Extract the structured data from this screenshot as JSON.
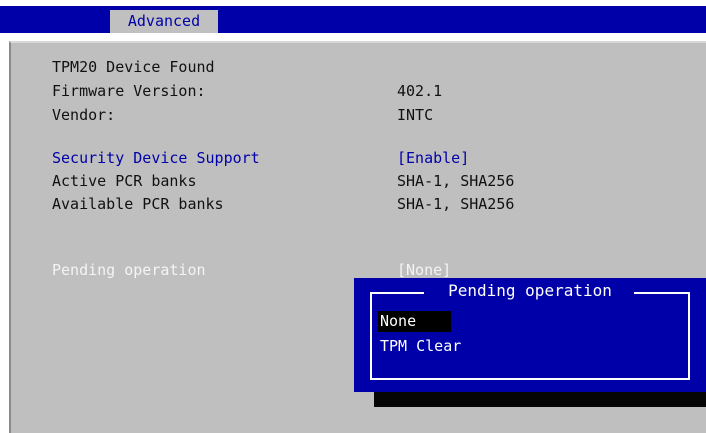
{
  "header": {
    "tab_label": "Advanced"
  },
  "info": {
    "tpm_device": "TPM20 Device Found",
    "firmware_label": "Firmware Version:",
    "firmware_value": "402.1",
    "vendor_label": "Vendor:",
    "vendor_value": "INTC"
  },
  "settings": {
    "security_label": "Security Device Support",
    "security_value": "[Enable]",
    "active_pcr_label": "Active PCR banks",
    "active_pcr_value": "SHA-1, SHA256",
    "available_pcr_label": "Available PCR banks",
    "available_pcr_value": "SHA-1, SHA256",
    "pending_label": "Pending operation",
    "pending_value": "[None]"
  },
  "popup": {
    "title": "Pending operation",
    "options": [
      "None",
      "TPM Clear"
    ],
    "selected": "None"
  },
  "colors": {
    "bios_blue": "#0000a8",
    "panel_gray": "#bfbfbf",
    "highlight_black": "#000000"
  }
}
